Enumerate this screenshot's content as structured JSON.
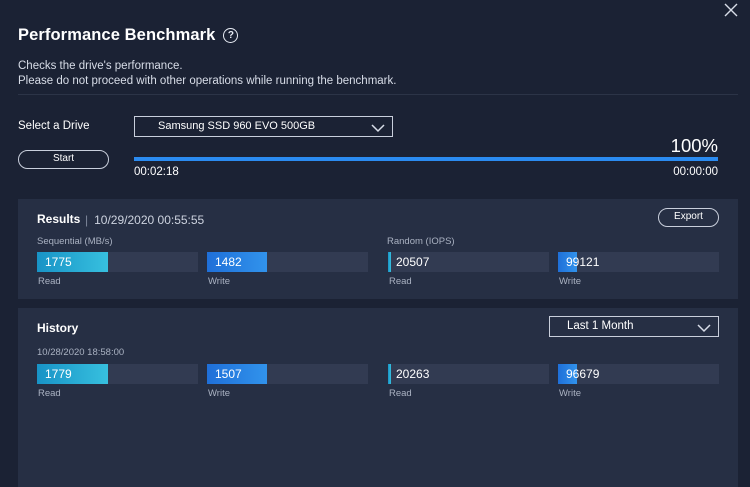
{
  "header": {
    "title": "Performance Benchmark",
    "help_glyph": "?",
    "desc_line1": "Checks the drive's performance.",
    "desc_line2": "Please do not proceed with other operations while running the benchmark."
  },
  "controls": {
    "select_label": "Select a Drive",
    "drive_value": "Samsung SSD 960 EVO 500GB",
    "start_label": "Start",
    "progress_pct": "100%",
    "progress_fraction": 1.0,
    "elapsed": "00:02:18",
    "remaining": "00:00:00"
  },
  "results": {
    "title": "Results",
    "separator": "|",
    "date": "10/29/2020 00:55:55",
    "export_label": "Export",
    "seq_label": "Sequential (MB/s)",
    "rand_label": "Random (IOPS)",
    "seq_read": "1775",
    "seq_write": "1482",
    "rand_read": "20507",
    "rand_write": "99121",
    "seq_read_frac": 0.44,
    "seq_write_frac": 0.37,
    "rand_read_frac": 0.02,
    "rand_write_frac": 0.12,
    "read_label": "Read",
    "write_label": "Write"
  },
  "history": {
    "title": "History",
    "period": "Last 1 Month",
    "date": "10/28/2020 18:58:00",
    "seq_read": "1779",
    "seq_write": "1507",
    "rand_read": "20263",
    "rand_write": "96679",
    "seq_read_frac": 0.44,
    "seq_write_frac": 0.37,
    "rand_read_frac": 0.02,
    "rand_write_frac": 0.12,
    "read_label": "Read",
    "write_label": "Write"
  },
  "colors": {
    "background": "#1b2234",
    "panel": "#262f44",
    "progress": "#2b8bf0",
    "seq_bar": "#37c0df",
    "write_bar": "#3193ec"
  },
  "icons": {
    "close": "close-icon",
    "help": "help-icon",
    "dropdown": "chevron-down-icon"
  }
}
